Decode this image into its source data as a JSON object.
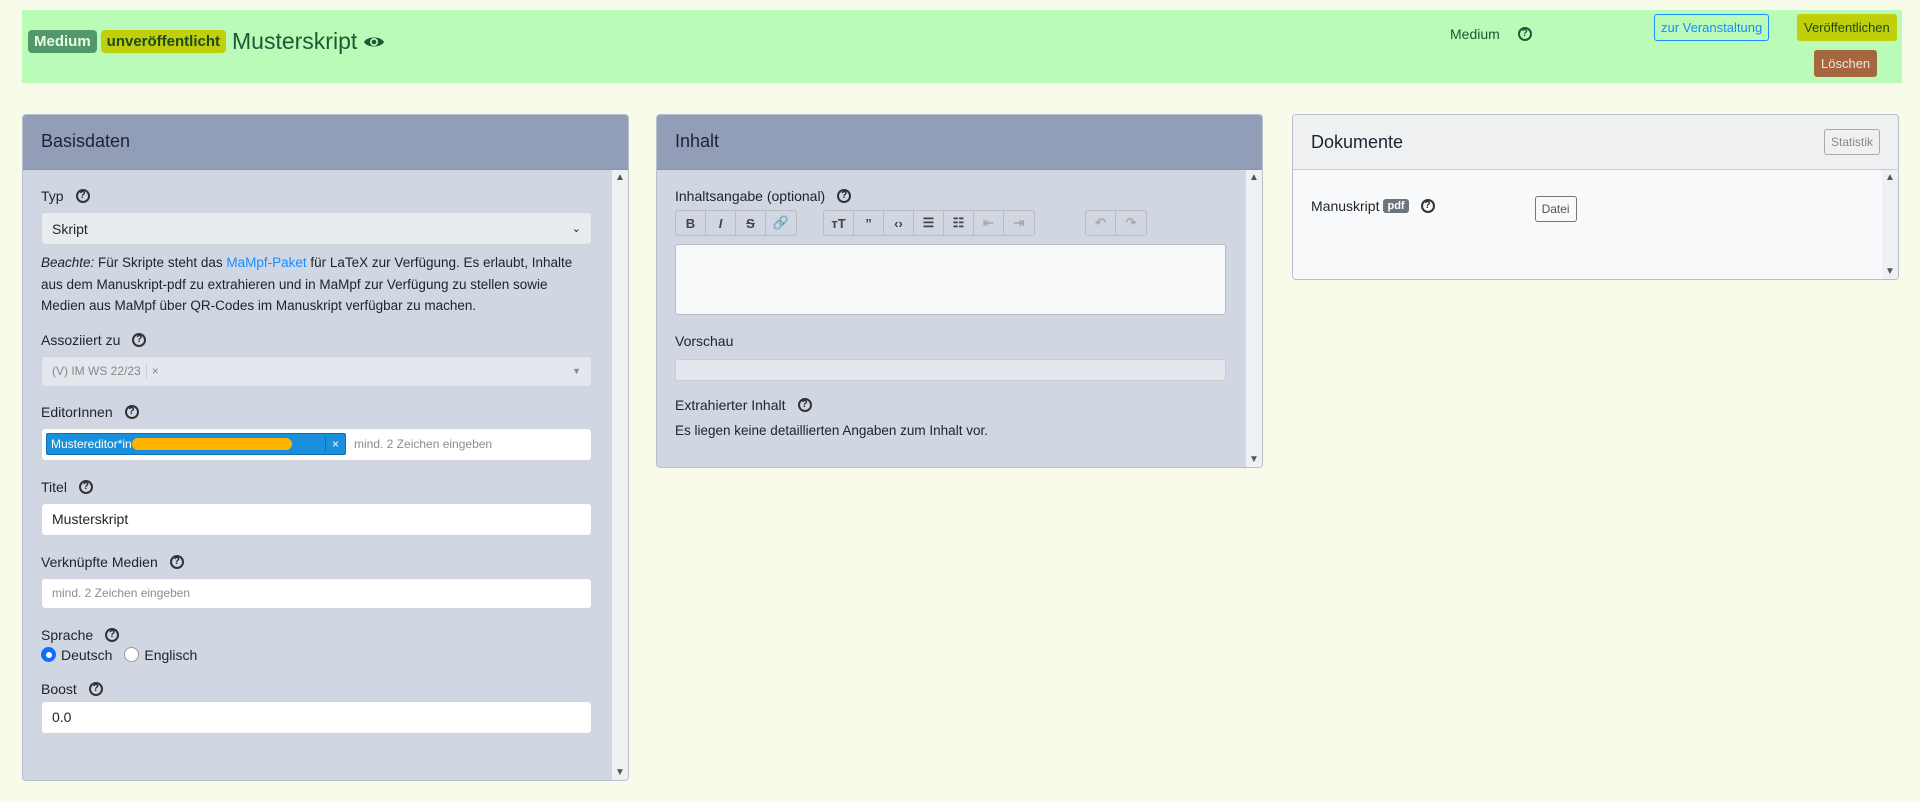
{
  "header": {
    "badge_type": "Medium",
    "badge_status": "unveröffentlicht",
    "title": "Musterskript",
    "type_label": "Medium",
    "btn_event": "zur Veranstaltung",
    "btn_publish": "Veröffentlichen",
    "btn_delete": "Löschen"
  },
  "basis": {
    "title": "Basisdaten",
    "typ_label": "Typ",
    "typ_value": "Skript",
    "note_em": "Beachte:",
    "note_pre": " Für Skripte steht das ",
    "note_link": "MaMpf-Paket",
    "note_post": " für LaTeX zur Verfügung. Es erlaubt, Inhalte aus dem Manuskript-pdf zu extrahieren und in MaMpf zur Verfügung zu stellen sowie Medien aus MaMpf über QR-Codes im Manuskript verfügbar zu machen.",
    "assoc_label": "Assoziiert zu",
    "assoc_value": "(V) IM WS 22/23",
    "remove": "×",
    "editors_label": "EditorInnen",
    "editor_tag": "Mustereditor*in",
    "editor_placeholder": "mind. 2 Zeichen eingeben",
    "titel_label": "Titel",
    "titel_value": "Musterskript",
    "linked_label": "Verknüpfte Medien",
    "linked_placeholder": "mind. 2 Zeichen eingeben",
    "lang_label": "Sprache",
    "lang_options": [
      "Deutsch",
      "Englisch"
    ],
    "lang_selected": "Deutsch",
    "boost_label": "Boost",
    "boost_value": "0.0"
  },
  "inhalt": {
    "title": "Inhalt",
    "summary_label": "Inhaltsangabe (optional)",
    "preview_label": "Vorschau",
    "extracted_label": "Extrahierter Inhalt",
    "extracted_text": "Es liegen keine detaillierten Angaben zum Inhalt vor."
  },
  "dokumente": {
    "title": "Dokumente",
    "stats_btn": "Statistik",
    "manuscript_label": "Manuskript",
    "pdf_badge": "pdf",
    "file_btn": "Datei"
  },
  "colors": {
    "header_bg": "#b9fbb7",
    "card_header": "#929eb8",
    "accent": "#1a8cff"
  }
}
